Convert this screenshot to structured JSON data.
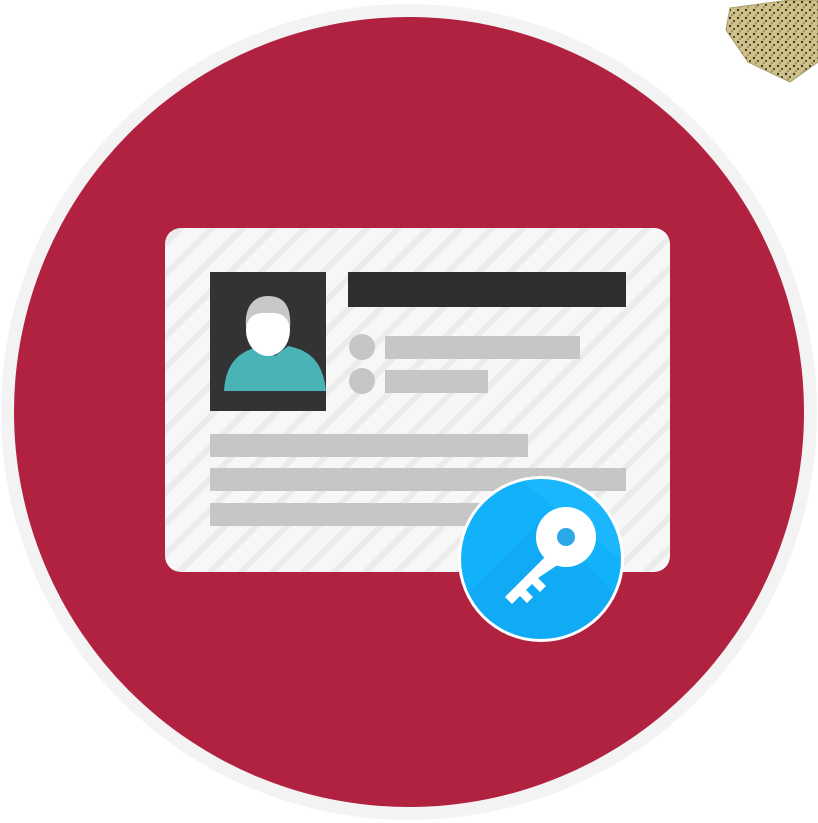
{
  "icon": {
    "badge_name": "identity-card-with-key",
    "colors": {
      "circle": "#b12240",
      "circle_border": "#ffffff",
      "card": "#f7f7f7",
      "card_stripes": "#e9e9e9",
      "photo_frame": "#333235",
      "avatar_head": "#ffffff",
      "avatar_hair": "#c8c8c8",
      "avatar_shirt": "#4ab3b6",
      "name_bar": "#2e2d30",
      "info_lines": "#c6c6c6",
      "key_badge": "#12b2fb",
      "key_badge_dark": "#0a9fe6",
      "key": "#ffffff",
      "key_hole": "#2aa8e8",
      "corner_texture": "#c9b97a"
    },
    "glyphs": {
      "avatar": "person-icon",
      "key": "key-icon",
      "card": "id-card-icon",
      "corner": "leaf-texture-fragment"
    }
  }
}
